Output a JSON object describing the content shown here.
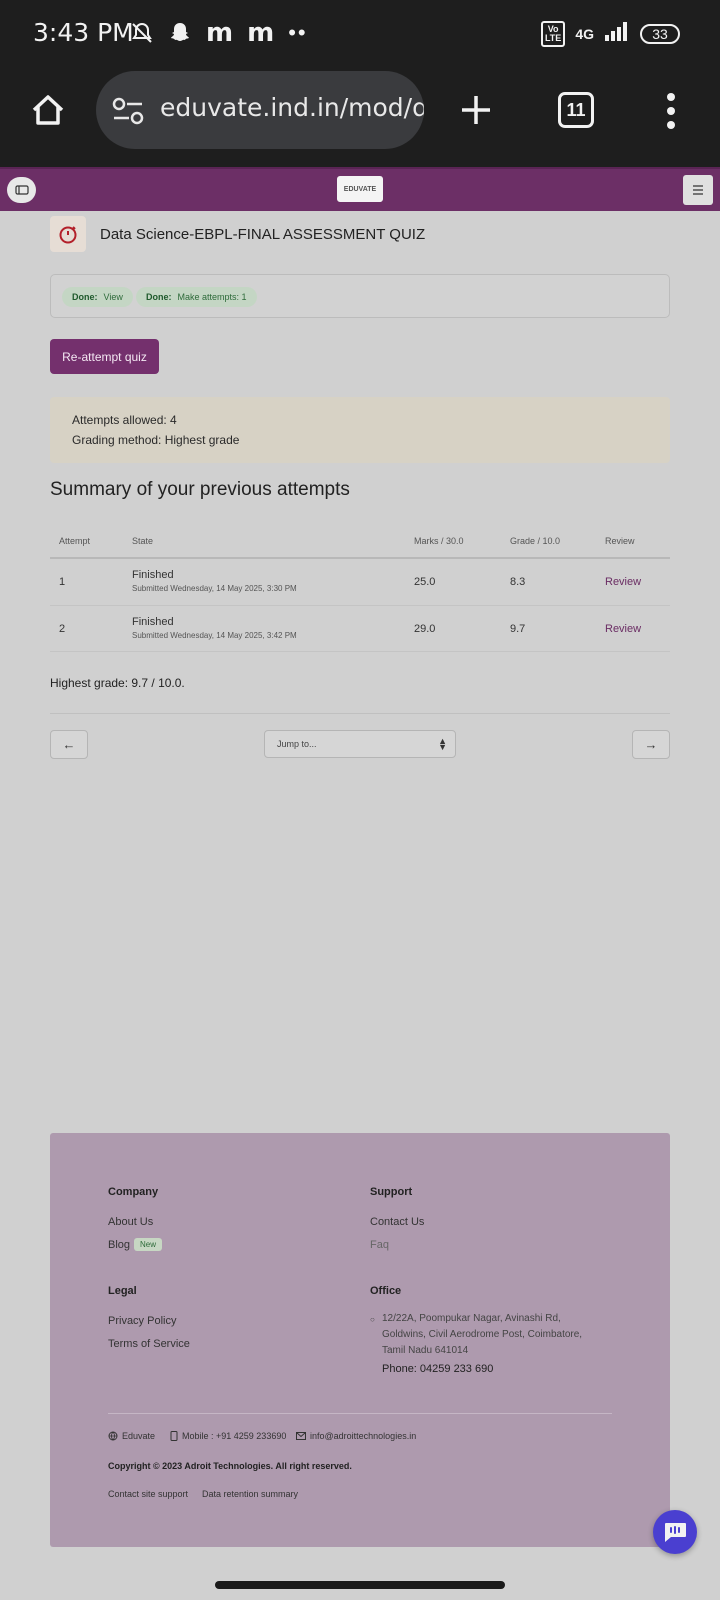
{
  "status_bar": {
    "time": "3:43 PM",
    "m1": "m",
    "m2": "m",
    "dots": "••",
    "volte": "Vo\nLTE",
    "network": "4G",
    "battery": "33"
  },
  "browser": {
    "url": "eduvate.ind.in/mod/q",
    "tab_count": "11"
  },
  "header": {
    "logo_text": "EDUVATE"
  },
  "quiz": {
    "title": "Data Science-EBPL-FINAL ASSESSMENT QUIZ",
    "completion": [
      {
        "status": "Done:",
        "label": "View"
      },
      {
        "status": "Done:",
        "label": "Make attempts: 1"
      }
    ],
    "reattempt_label": "Re-attempt quiz",
    "attempts_allowed": "Attempts allowed: 4",
    "grading_method": "Grading method: Highest grade"
  },
  "summary": {
    "title": "Summary of your previous attempts",
    "headers": [
      "Attempt",
      "State",
      "Marks / 30.0",
      "Grade / 10.0",
      "Review"
    ],
    "rows": [
      {
        "attempt": "1",
        "state": "Finished",
        "submitted": "Submitted Wednesday, 14 May 2025, 3:30 PM",
        "marks": "25.0",
        "grade": "8.3",
        "review": "Review"
      },
      {
        "attempt": "2",
        "state": "Finished",
        "submitted": "Submitted Wednesday, 14 May 2025, 3:42 PM",
        "marks": "29.0",
        "grade": "9.7",
        "review": "Review"
      }
    ],
    "highest_grade": "Highest grade: 9.7 / 10.0."
  },
  "navigation": {
    "prev": "←",
    "next": "→",
    "jump_placeholder": "Jump to..."
  },
  "footer": {
    "company_heading": "Company",
    "about": "About Us",
    "blog": "Blog",
    "new_badge": "New",
    "support_heading": "Support",
    "contact": "Contact Us",
    "faq": "Faq",
    "legal_heading": "Legal",
    "privacy": "Privacy Policy",
    "terms": "Terms of Service",
    "office_heading": "Office",
    "address": "12/22A, Poompukar Nagar, Avinashi Rd, Goldwins, Civil Aerodrome Post, Coimbatore, Tamil Nadu 641014",
    "phone": "Phone: 04259 233 690",
    "site_name": "Eduvate",
    "mobile": "Mobile : +91 4259 233690",
    "email": "info@adroittechnologies.in",
    "copyright": "Copyright © 2023 Adroit Technologies. All right reserved.",
    "site_support": "Contact site support",
    "data_retention": "Data retention summary"
  },
  "colors": {
    "brand": "#6c2f66",
    "button": "#74306d",
    "footer_bg": "#ae9aae",
    "done_chip": "#c4d6c4",
    "chat": "#4a3fd0"
  }
}
